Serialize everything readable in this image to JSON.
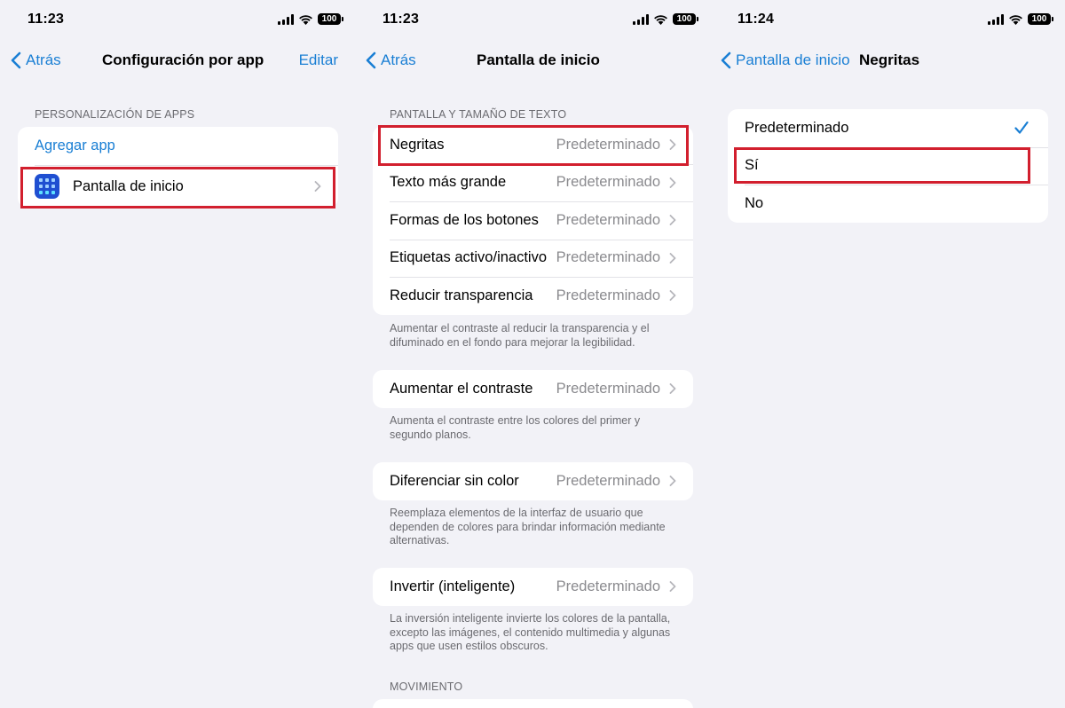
{
  "accent": "#1a7fd4",
  "highlight_color": "#d21f2e",
  "panel1": {
    "time": "11:23",
    "battery": "100",
    "back_label": "Atrás",
    "title": "Configuración por app",
    "right_action": "Editar",
    "section_header": "PERSONALIZACIÓN DE APPS",
    "add_app": "Agregar app",
    "app_item": {
      "label": "Pantalla de inicio",
      "icon": "home-screen-icon"
    }
  },
  "panel2": {
    "time": "11:23",
    "battery": "100",
    "back_label": "Atrás",
    "title": "Pantalla de inicio",
    "section_header": "PANTALLA Y TAMAÑO DE TEXTO",
    "rows": [
      {
        "label": "Negritas",
        "value": "Predeterminado"
      },
      {
        "label": "Texto más grande",
        "value": "Predeterminado"
      },
      {
        "label": "Formas de los botones",
        "value": "Predeterminado"
      },
      {
        "label": "Etiquetas activo/inactivo",
        "value": "Predeterminado"
      },
      {
        "label": "Reducir transparencia",
        "value": "Predeterminado"
      }
    ],
    "footer1": "Aumentar el contraste al reducir la transparencia y el difuminado en el fondo para mejorar la legibilidad.",
    "contrast": {
      "label": "Aumentar el contraste",
      "value": "Predeterminado"
    },
    "footer2": "Aumenta el contraste entre los colores del primer y segundo planos.",
    "diff": {
      "label": "Diferenciar sin color",
      "value": "Predeterminado"
    },
    "footer3": "Reemplaza elementos de la interfaz de usuario que dependen de colores para brindar información mediante alternativas.",
    "invert": {
      "label": "Invertir (inteligente)",
      "value": "Predeterminado"
    },
    "footer4": "La inversión inteligente invierte los colores de la pantalla, excepto las imágenes, el contenido multimedia y algunas apps que usen estilos obscuros.",
    "section_header2": "MOVIMIENTO"
  },
  "panel3": {
    "time": "11:24",
    "battery": "100",
    "back_label": "Pantalla de inicio",
    "title": "Negritas",
    "options": [
      {
        "label": "Predeterminado",
        "selected": true
      },
      {
        "label": "Sí",
        "selected": false
      },
      {
        "label": "No",
        "selected": false
      }
    ]
  }
}
